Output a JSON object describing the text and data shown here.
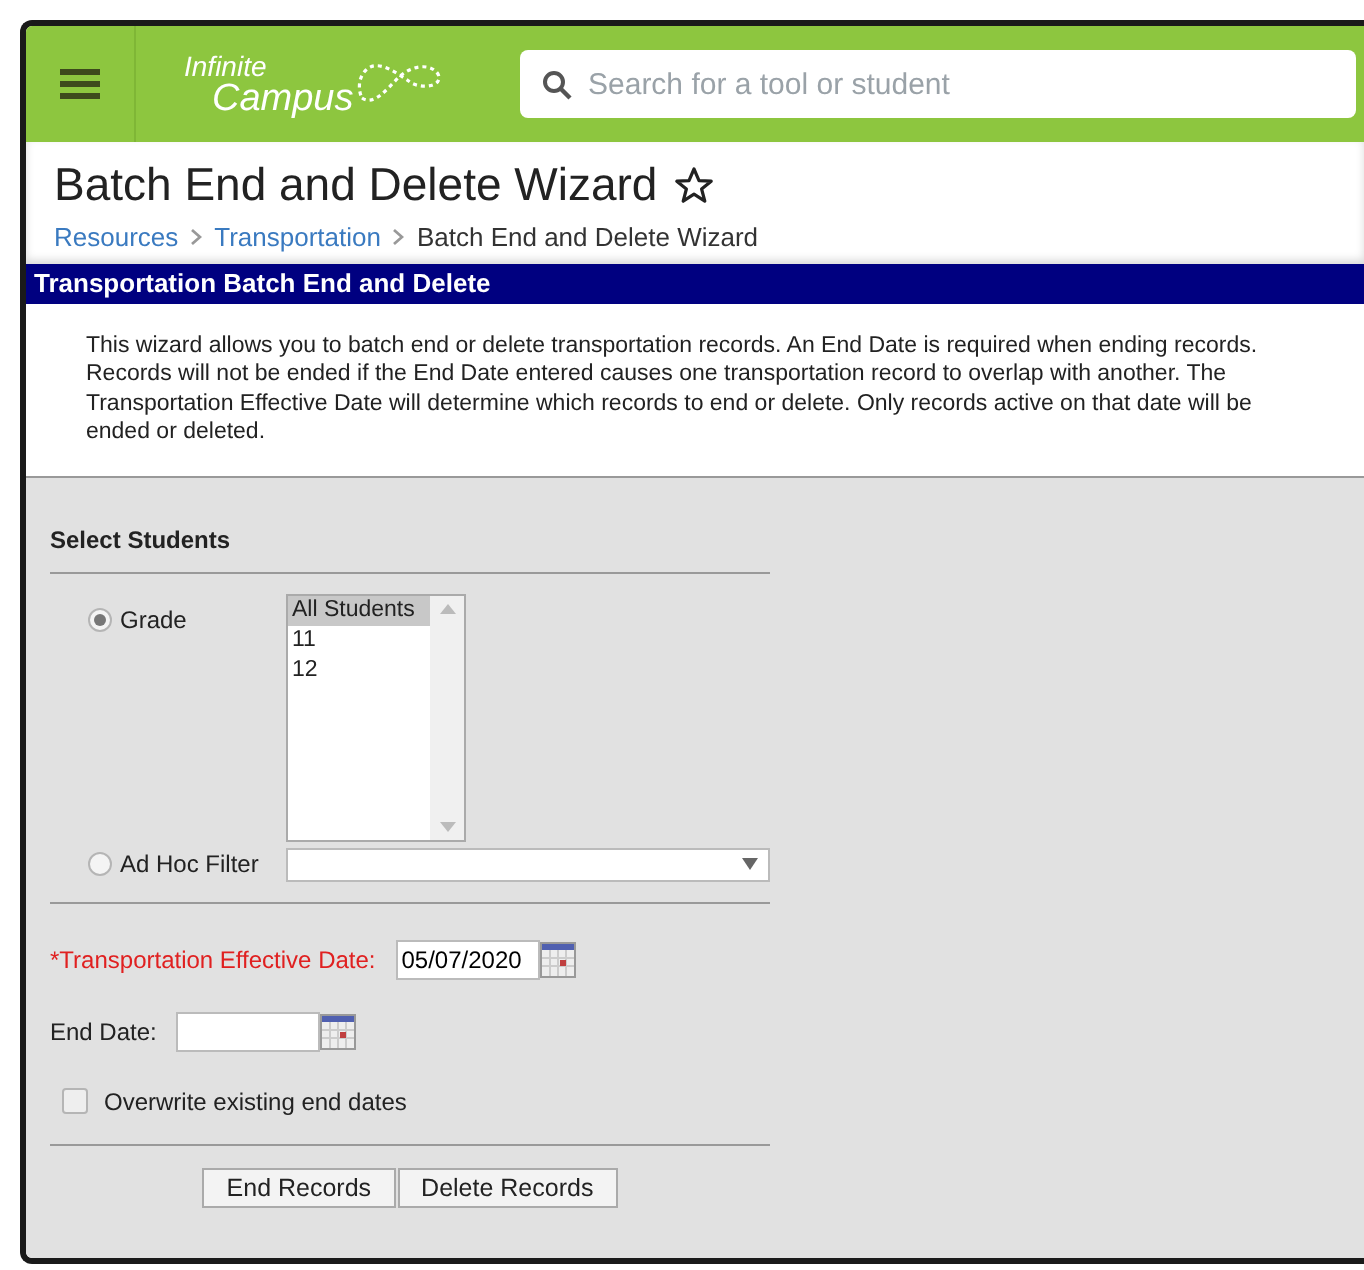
{
  "header": {
    "logo": [
      "Infinite",
      "Campus"
    ],
    "search": {
      "placeholder": "Search for a tool or student"
    }
  },
  "page": {
    "title": "Batch End and Delete Wizard",
    "favorite": false,
    "breadcrumbs": [
      "Resources",
      "Transportation",
      "Batch End and Delete Wizard"
    ]
  },
  "panel": {
    "title": "Transportation Batch End and Delete",
    "description": "This wizard allows you to batch end or delete transportation records. An End Date is required when ending records. Records will not be ended if the End Date entered causes one transportation record to overlap with another. The Transportation Effective Date will determine which records to end or delete. Only records active on that date will be ended or deleted.",
    "section": "Select Students",
    "filters": [
      {
        "label": "Grade",
        "selected": true,
        "kind": "list",
        "options": [
          {
            "label": "All Students",
            "selected": true
          },
          {
            "label": "11",
            "selected": false
          },
          {
            "label": "12",
            "selected": false
          }
        ]
      },
      {
        "label": "Ad Hoc Filter",
        "selected": false,
        "kind": "dropdown"
      }
    ],
    "dates": [
      {
        "label": "*Transportation Effective Date:",
        "value": "05/07/2020",
        "required": true
      },
      {
        "label": "End Date:",
        "required": false
      }
    ],
    "overwrite": {
      "label": "Overwrite existing end dates",
      "checked": false
    },
    "buttons": [
      "End Records",
      "Delete Records"
    ]
  }
}
